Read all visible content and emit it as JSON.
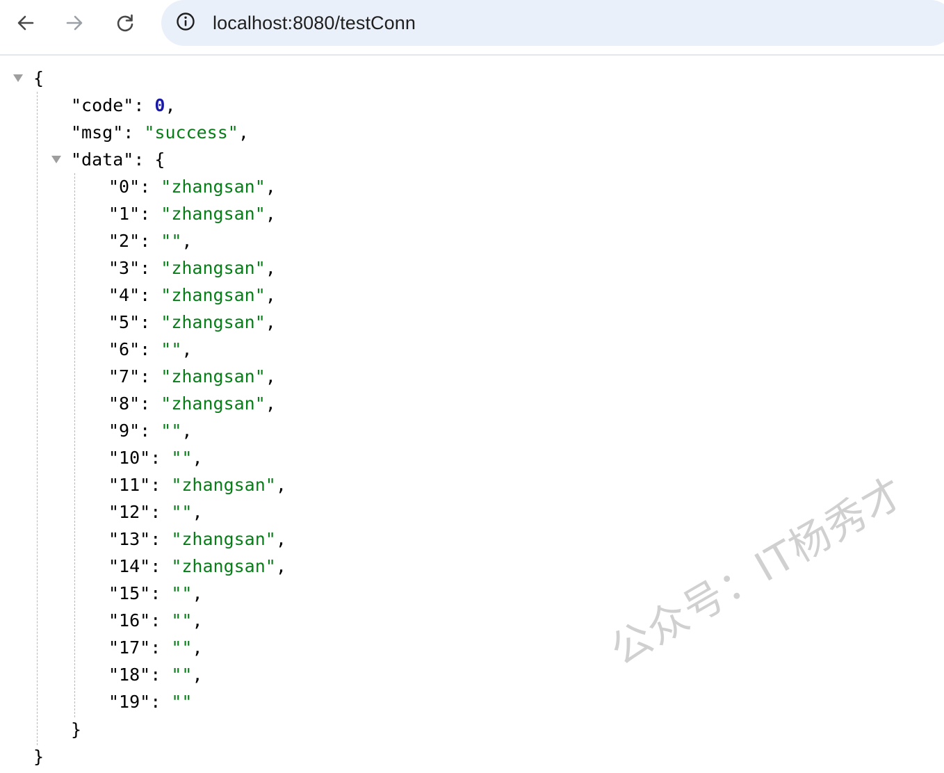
{
  "browser": {
    "url": "localhost:8080/testConn",
    "back_icon": "arrow-left-icon",
    "forward_icon": "arrow-right-icon",
    "reload_icon": "reload-icon",
    "site_info_icon": "info-circle-icon"
  },
  "json": {
    "code_key": "\"code\"",
    "code_value": "0",
    "msg_key": "\"msg\"",
    "msg_value": "\"success\"",
    "data_key": "\"data\"",
    "data_entries": [
      {
        "key": "\"0\"",
        "value": "\"zhangsan\""
      },
      {
        "key": "\"1\"",
        "value": "\"zhangsan\""
      },
      {
        "key": "\"2\"",
        "value": "\"\""
      },
      {
        "key": "\"3\"",
        "value": "\"zhangsan\""
      },
      {
        "key": "\"4\"",
        "value": "\"zhangsan\""
      },
      {
        "key": "\"5\"",
        "value": "\"zhangsan\""
      },
      {
        "key": "\"6\"",
        "value": "\"\""
      },
      {
        "key": "\"7\"",
        "value": "\"zhangsan\""
      },
      {
        "key": "\"8\"",
        "value": "\"zhangsan\""
      },
      {
        "key": "\"9\"",
        "value": "\"\""
      },
      {
        "key": "\"10\"",
        "value": "\"\""
      },
      {
        "key": "\"11\"",
        "value": "\"zhangsan\""
      },
      {
        "key": "\"12\"",
        "value": "\"\""
      },
      {
        "key": "\"13\"",
        "value": "\"zhangsan\""
      },
      {
        "key": "\"14\"",
        "value": "\"zhangsan\""
      },
      {
        "key": "\"15\"",
        "value": "\"\""
      },
      {
        "key": "\"16\"",
        "value": "\"\""
      },
      {
        "key": "\"17\"",
        "value": "\"\""
      },
      {
        "key": "\"18\"",
        "value": "\"\""
      },
      {
        "key": "\"19\"",
        "value": "\"\""
      }
    ]
  },
  "watermark": "公众号：IT杨秀才",
  "colors": {
    "string": "#067d17",
    "number": "#1a1aa6",
    "omnibox": "#eaf0f9"
  }
}
